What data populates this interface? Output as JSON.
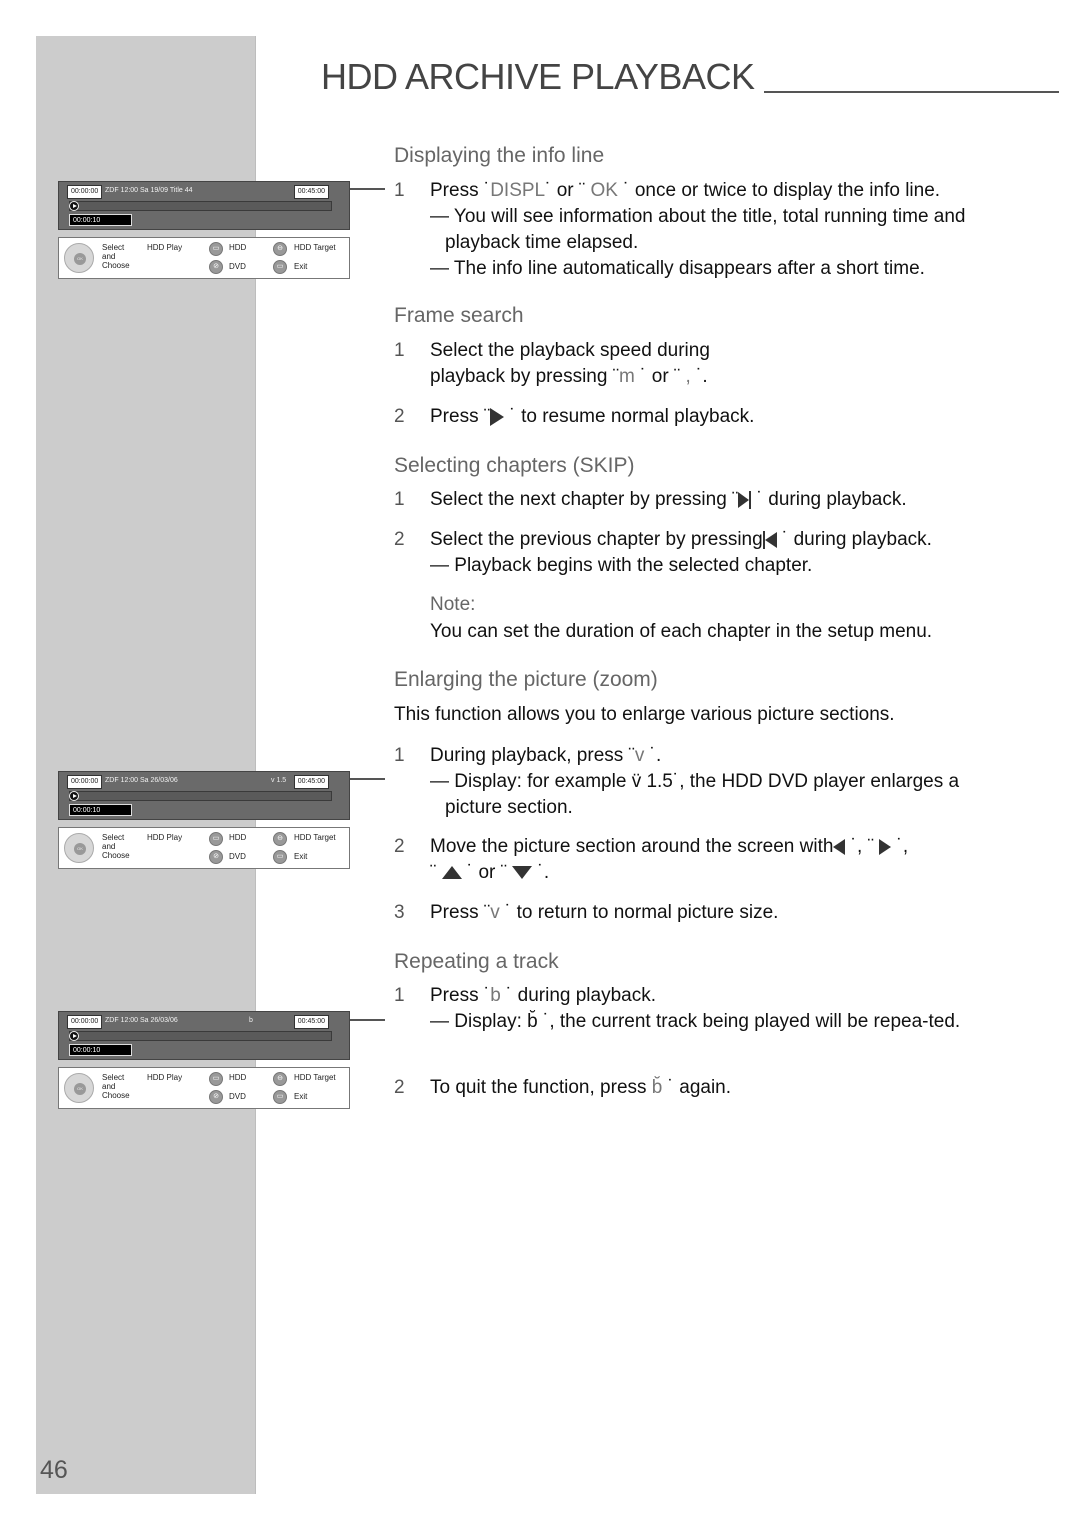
{
  "page": {
    "title": "HDD ARCHIVE PLAYBACK",
    "page_number": "46"
  },
  "osd_screens": [
    {
      "time_start": "00:00:00",
      "info": "ZDF  12:00 Sa  19/09 Title 44",
      "zoom_indicator": "",
      "time_total": "00:45:00",
      "elapsed": "00:00:10"
    },
    {
      "time_start": "00:00:00",
      "info": "ZDF  12:00 Sa  26/03/06",
      "zoom_indicator": "v    1.5",
      "time_total": "00:45:00",
      "elapsed": "00:00:10"
    },
    {
      "time_start": "00:00:00",
      "info": "ZDF  12:00 Sa  26/03/06",
      "zoom_indicator": "b",
      "time_total": "00:45:00",
      "elapsed": "00:00:10"
    }
  ],
  "osd_panel": {
    "dpad_center": "OK",
    "select_label": [
      "Select",
      "and",
      "Choose"
    ],
    "mode_label": "HDD Play",
    "buttons": [
      {
        "icon": "folder-icon",
        "label": "HDD"
      },
      {
        "icon": "target-icon",
        "label": "HDD Target"
      },
      {
        "icon": "disc-icon",
        "label": "DVD"
      },
      {
        "icon": "exit-icon",
        "label": "Exit"
      }
    ]
  },
  "sections": {
    "info_line": {
      "heading": "Displaying the info line",
      "step1_num": "1",
      "step1_a": "Press ˙",
      "step1_key1": "DISPL",
      "step1_b": "˙ or ¨ ",
      "step1_key2": "OK",
      "step1_c": " ˙ once or twice to display the info line.",
      "step1_sub1": "— You will see information about the title, total running time and playback time elapsed.",
      "step1_sub2": "— The info line automatically disappears after a short time."
    },
    "frame_search": {
      "heading": "Frame search",
      "step1_num": "1",
      "step1_line1": "Select the playback speed during",
      "step1_line2_a": "playback by pressing ¨",
      "step1_key1": "m",
      "step1_line2_b": "   ˙ or ¨ ",
      "step1_key2": ",",
      "step1_line2_c": "     ˙.",
      "step2_num": "2",
      "step2_a": "Press ¨",
      "step2_b": " ˙ to resume normal playback."
    },
    "chapters": {
      "heading": "Selecting chapters (SKIP)",
      "step1_num": "1",
      "step1_a": "Select the next chapter by pressing ¨",
      "step1_b": " ˙ during playback.",
      "step2_num": "2",
      "step2_a": "Select the previous chapter by pressing",
      "step2_b": " ˙ during playback.",
      "step2_sub": "— Playback begins with the selected chapter.",
      "note_label": "Note:",
      "note_text": "You can set the duration of each chapter in the setup menu."
    },
    "zoom": {
      "heading": "Enlarging the picture (zoom)",
      "intro": "This function allows you to enlarge various picture sections.",
      "step1_num": "1",
      "step1_a": "During playback, press ¨",
      "step1_key": "v",
      "step1_b": "    ˙.",
      "step1_sub_a": "— Display:  for  example ",
      "step1_sub_key": "v̈",
      "step1_sub_b": "      1.5˙,  the  HDD  DVD  player enlarges a picture section.",
      "step2_num": "2",
      "step2_a": "Move the picture section around the screen with",
      "step2_b": " ˙, ¨ ",
      "step2_c": " ˙,",
      "step2_d": "¨ ",
      "step2_e": " ˙ or ¨ ",
      "step2_f": " ˙.",
      "step3_num": "3",
      "step3_a": "Press ¨",
      "step3_key": "v",
      "step3_b": "     ˙ to return to normal picture size."
    },
    "repeat": {
      "heading": "Repeating a track",
      "step1_num": "1",
      "step1_a": "Press ˙",
      "step1_key": "b",
      "step1_b": "     ˙ during playback.",
      "step1_sub_a": "— Display: ",
      "step1_sub_key": "b̆",
      "step1_sub_b": "     ˙, the current track being played will be repea-ted.",
      "step2_num": "2",
      "step2_a": "To quit the function, press ",
      "step2_key": "b̆",
      "step2_b": "     ˙ again."
    }
  }
}
